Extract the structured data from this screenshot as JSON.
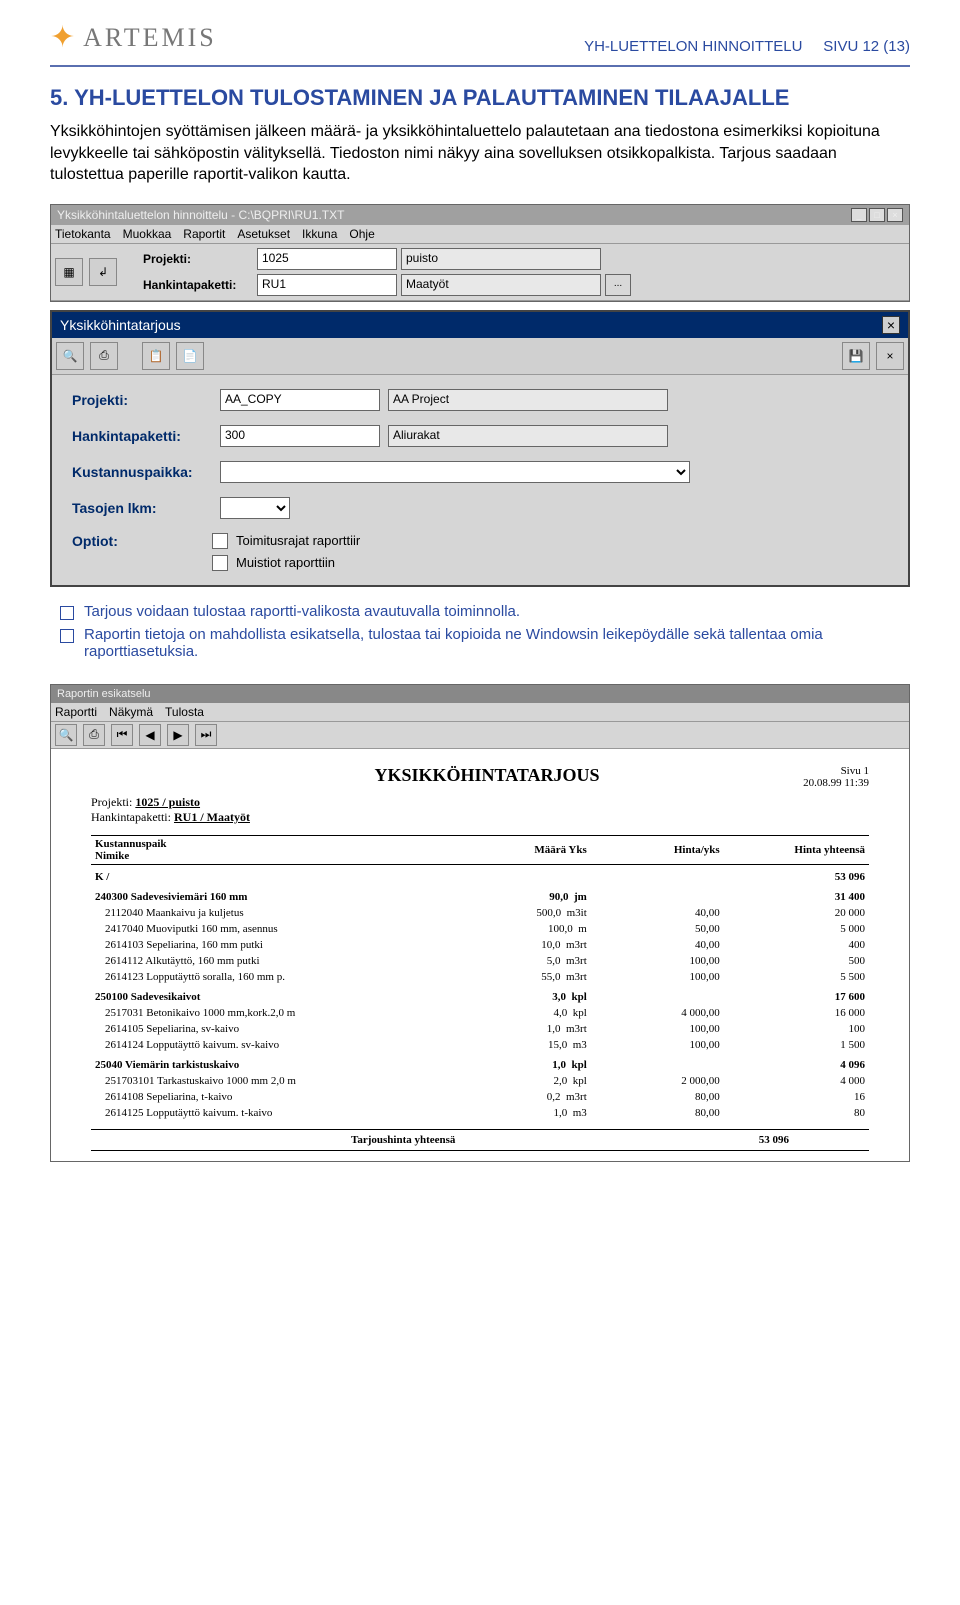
{
  "header": {
    "doc_title": "YH-LUETTELON HINNOITTELU",
    "page_label": "SIVU 12 (13)",
    "logo_text": "ARTEMIS"
  },
  "section": {
    "title": "5. YH-LUETTELON TULOSTAMINEN JA PALAUTTAMINEN TILAAJALLE"
  },
  "body_text": "Yksikköhintojen syöttämisen jälkeen määrä- ja yksikköhintaluettelo palautetaan ana tiedostona esimerkiksi kopioituna levykkeelle tai sähköpostin välityksellä. Tiedoston nimi näkyy aina sovelluksen otsikkopalkista. Tarjous saadaan tulostettua paperille raportit-valikon kautta.",
  "app1": {
    "title": "Yksikköhintaluettelon hinnoittelu - C:\\BQPRI\\RU1.TXT",
    "menus": [
      "Tietokanta",
      "Muokkaa",
      "Raportit",
      "Asetukset",
      "Ikkuna",
      "Ohje"
    ],
    "labels": {
      "projekti": "Projekti:",
      "hankinta": "Hankintapaketti:"
    },
    "projekti_code": "1025",
    "projekti_name": "puisto",
    "hankinta_code": "RU1",
    "hankinta_name": "Maatyöt"
  },
  "modal": {
    "title": "Yksikköhintatarjous",
    "labels": {
      "projekti": "Projekti:",
      "hankinta": "Hankintapaketti:",
      "kust": "Kustannuspaikka:",
      "tasot": "Tasojen lkm:",
      "optiot": "Optiot:"
    },
    "projekti_code": "AA_COPY",
    "projekti_name": "AA Project",
    "hankinta_code": "300",
    "hankinta_name": "Aliurakat",
    "opt1": "Toimitusrajat raporttiir",
    "opt2": "Muistiot raporttiin"
  },
  "bullets": [
    "Tarjous voidaan tulostaa raportti-valikosta avautuvalla toiminnolla.",
    "Raportin tietoja on mahdollista esikatsella, tulostaa tai kopioida ne Windowsin leikepöydälle sekä tallentaa omia raporttiasetuksia."
  ],
  "report": {
    "win_title": "Raportin esikatselu",
    "menus": [
      "Raportti",
      "Näkymä",
      "Tulosta"
    ],
    "title": "YKSIKKÖHINTATARJOUS",
    "page_side": "Sivu  1",
    "date": "20.08.99  11:39",
    "proj_lbl": "Projekti:",
    "proj_val": "1025 / puisto",
    "hank_lbl": "Hankintapaketti:",
    "hank_val": "RU1 / Maatyöt",
    "col_kust": "Kustannuspaik",
    "col_nimike": "Nimike",
    "col_maara": "Määrä Yks",
    "col_hinta": "Hinta/yks",
    "col_yht": "Hinta yhteensä",
    "groups": [
      {
        "code": "K /",
        "total": "53 096",
        "rows": []
      },
      {
        "code": "240300 Sadevesiviemäri 160 mm",
        "maara": "90,0",
        "yks": "jm",
        "hinta": "",
        "total": "31 400",
        "rows": [
          {
            "n": "2112040 Maankaivu ja kuljetus",
            "m": "500,0",
            "y": "m3it",
            "h": "40,00",
            "t": "20 000"
          },
          {
            "n": "2417040 Muoviputki 160 mm, asennus",
            "m": "100,0",
            "y": "m",
            "h": "50,00",
            "t": "5 000"
          },
          {
            "n": "2614103 Sepeliarina, 160 mm putki",
            "m": "10,0",
            "y": "m3rt",
            "h": "40,00",
            "t": "400"
          },
          {
            "n": "2614112 Alkutäyttö, 160 mm putki",
            "m": "5,0",
            "y": "m3rt",
            "h": "100,00",
            "t": "500"
          },
          {
            "n": "2614123 Lopputäyttö soralla, 160 mm p.",
            "m": "55,0",
            "y": "m3rt",
            "h": "100,00",
            "t": "5 500"
          }
        ]
      },
      {
        "code": "250100 Sadevesikaivot",
        "maara": "3,0",
        "yks": "kpl",
        "hinta": "",
        "total": "17 600",
        "rows": [
          {
            "n": "2517031 Betonikaivo 1000 mm,kork.2,0 m",
            "m": "4,0",
            "y": "kpl",
            "h": "4 000,00",
            "t": "16 000"
          },
          {
            "n": "2614105 Sepeliarina, sv-kaivo",
            "m": "1,0",
            "y": "m3rt",
            "h": "100,00",
            "t": "100"
          },
          {
            "n": "2614124 Lopputäyttö kaivum. sv-kaivo",
            "m": "15,0",
            "y": "m3",
            "h": "100,00",
            "t": "1 500"
          }
        ]
      },
      {
        "code": "25040 Viemärin tarkistuskaivo",
        "maara": "1,0",
        "yks": "kpl",
        "hinta": "",
        "total": "4 096",
        "rows": [
          {
            "n": "251703101 Tarkastuskaivo 1000 mm 2,0 m",
            "m": "2,0",
            "y": "kpl",
            "h": "2 000,00",
            "t": "4 000"
          },
          {
            "n": "2614108 Sepeliarina, t-kaivo",
            "m": "0,2",
            "y": "m3rt",
            "h": "80,00",
            "t": "16"
          },
          {
            "n": "2614125 Lopputäyttö kaivum. t-kaivo",
            "m": "1,0",
            "y": "m3",
            "h": "80,00",
            "t": "80"
          }
        ]
      }
    ],
    "total_lbl": "Tarjoushinta yhteensä",
    "total_val": "53 096"
  }
}
